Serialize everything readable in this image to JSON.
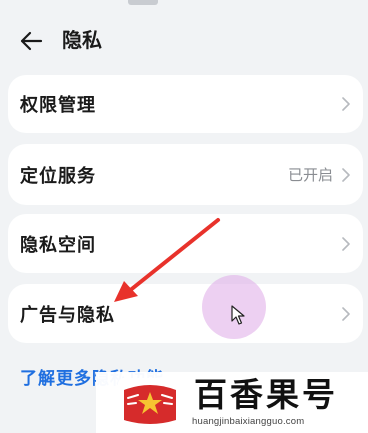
{
  "header": {
    "title": "隐私",
    "back_icon": "arrow-left-icon"
  },
  "settings": [
    {
      "label": "权限管理",
      "value": ""
    },
    {
      "label": "定位服务",
      "value": "已开启"
    },
    {
      "label": "隐私空间",
      "value": ""
    },
    {
      "label": "广告与隐私",
      "value": ""
    }
  ],
  "more_link": "了解更多隐私功能",
  "watermark": {
    "name": "百香果号",
    "url": "huangjinbaixiangguo.com"
  },
  "colors": {
    "background": "#f1f3f5",
    "card": "#ffffff",
    "link": "#1f6fe0",
    "annotation_arrow": "#e8322b",
    "touch_indicator": "#deaae8"
  }
}
